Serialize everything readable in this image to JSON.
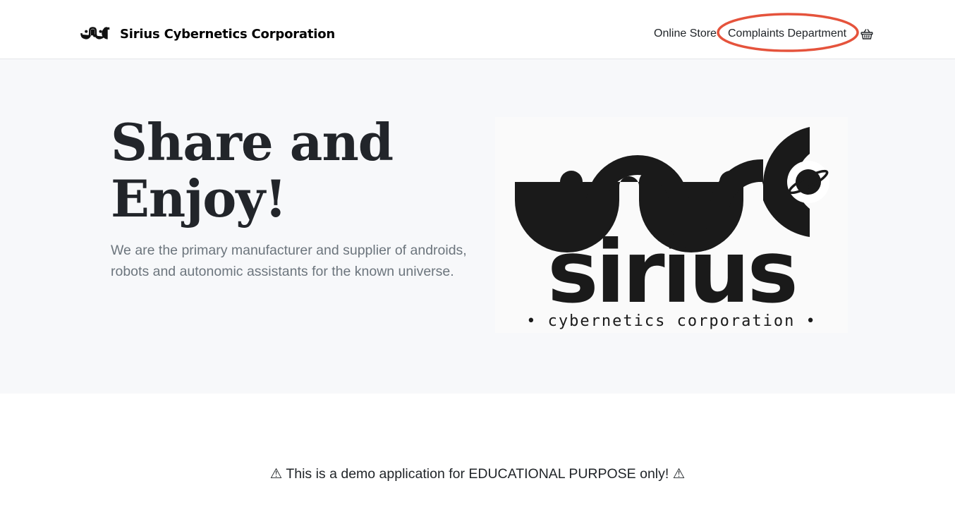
{
  "brand": {
    "name": "Sirius Cybernetics Corporation",
    "icon": "sirius-logo-icon"
  },
  "nav": {
    "online_store": "Online Store",
    "complaints": "Complaints Department",
    "cart_icon": "basket-icon"
  },
  "annotation": {
    "color": "#e5533c"
  },
  "hero": {
    "title": "Share and Enjoy!",
    "lead": "We are the primary manufacturer and supplier of androids, robots and autonomic assistants for the known universe.",
    "image": {
      "wordmark": "sirius",
      "tagline": "• cybernetics corporation •"
    }
  },
  "disclaimer": "⚠ This is a demo application for EDUCATIONAL PURPOSE only! ⚠"
}
